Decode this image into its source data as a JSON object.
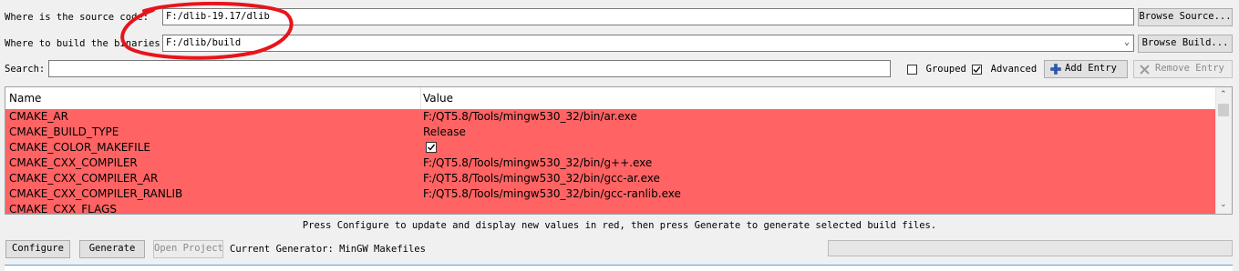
{
  "source": {
    "label": "Where is the source code:",
    "value": "F:/dlib-19.17/dlib",
    "browse_label": "Browse Source..."
  },
  "build": {
    "label": "Where to build the binaries:",
    "value": "F:/dlib/build",
    "browse_label": "Browse Build..."
  },
  "search": {
    "label": "Search:",
    "value": ""
  },
  "options": {
    "grouped_label": "Grouped",
    "grouped_checked": false,
    "advanced_label": "Advanced",
    "advanced_checked": true,
    "add_entry_label": "Add Entry",
    "remove_entry_label": "Remove Entry"
  },
  "table": {
    "columns": [
      "Name",
      "Value"
    ],
    "rows": [
      {
        "name": "CMAKE_AR",
        "value": "F:/QT5.8/Tools/mingw530_32/bin/ar.exe",
        "type": "text"
      },
      {
        "name": "CMAKE_BUILD_TYPE",
        "value": "Release",
        "type": "text"
      },
      {
        "name": "CMAKE_COLOR_MAKEFILE",
        "value": "",
        "type": "checkbox",
        "checked": true
      },
      {
        "name": "CMAKE_CXX_COMPILER",
        "value": "F:/QT5.8/Tools/mingw530_32/bin/g++.exe",
        "type": "text"
      },
      {
        "name": "CMAKE_CXX_COMPILER_AR",
        "value": "F:/QT5.8/Tools/mingw530_32/bin/gcc-ar.exe",
        "type": "text"
      },
      {
        "name": "CMAKE_CXX_COMPILER_RANLIB",
        "value": "F:/QT5.8/Tools/mingw530_32/bin/gcc-ranlib.exe",
        "type": "text"
      },
      {
        "name": "CMAKE_CXX_FLAGS",
        "value": "",
        "type": "text"
      }
    ],
    "new_entry_color": "#ff6363"
  },
  "status_text": "Press Configure to update and display new values in red, then press Generate to generate selected build files.",
  "actions": {
    "configure_label": "Configure",
    "generate_label": "Generate",
    "open_project_label": "Open Project",
    "generator_text": "Current Generator: MinGW Makefiles"
  },
  "annotation_color": "#e8141c"
}
